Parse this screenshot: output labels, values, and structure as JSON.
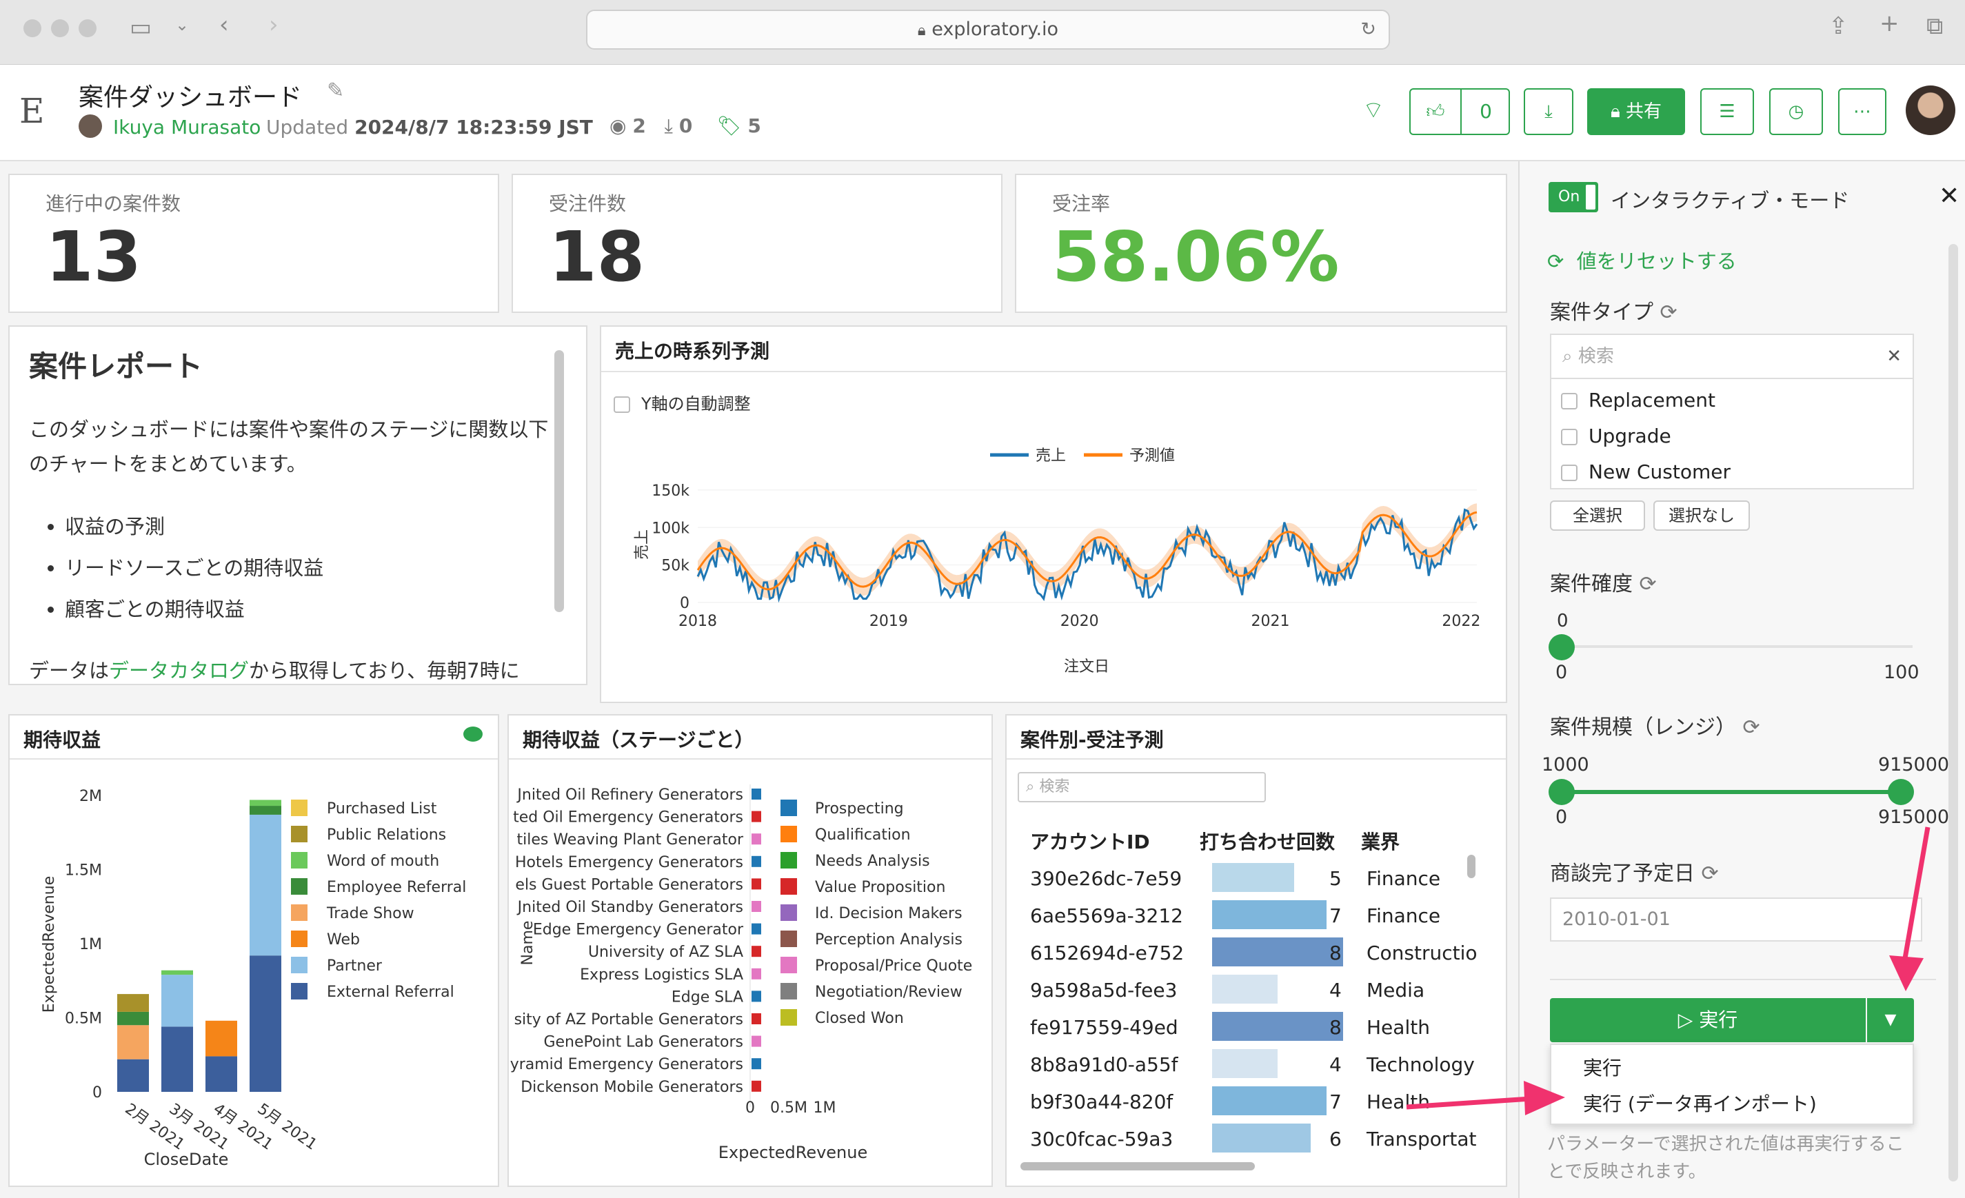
{
  "browser": {
    "url": "exploratory.io"
  },
  "header": {
    "logo": "E",
    "title": "案件ダッシュボード",
    "author": "Ikuya Murasato",
    "updated_label": "Updated",
    "updated_value": "2024/8/7 18:23:59 JST",
    "views": "2",
    "downloads": "0",
    "tags": "5",
    "like_count": "0",
    "share_label": "共有"
  },
  "kpis": [
    {
      "label": "進行中の案件数",
      "value": "13"
    },
    {
      "label": "受注件数",
      "value": "18"
    },
    {
      "label": "受注率",
      "value": "58.06%"
    }
  ],
  "report": {
    "title": "案件レポート",
    "intro": "このダッシュボードには案件や案件のステージに関数以下のチャートをまとめています。",
    "bullets": [
      "収益の予測",
      "リードソースごとの期待収益",
      "顧客ごとの期待収益"
    ],
    "footer_pre": "データは",
    "footer_link": "データカタログ",
    "footer_post": "から取得しており、毎朝7時に"
  },
  "forecast": {
    "title": "売上の時系列予測",
    "checkbox": "Y軸の自動調整"
  },
  "chart_data": [
    {
      "type": "line",
      "title": "売上の時系列予測",
      "xlabel": "注文日",
      "ylabel": "売上",
      "x_ticks": [
        "2018",
        "2019",
        "2020",
        "2021",
        "2022"
      ],
      "y_ticks": [
        "0",
        "50k",
        "100k",
        "150k"
      ],
      "ylim": [
        0,
        160000
      ],
      "legend": "top",
      "series": [
        {
          "name": "売上",
          "color": "#1f77b4"
        },
        {
          "name": "予測値",
          "color": "#ff7f0e"
        }
      ]
    },
    {
      "type": "bar",
      "title": "期待収益",
      "xlabel": "CloseDate",
      "ylabel": "ExpectedRevenue",
      "categories": [
        "2月 2021",
        "3月 2021",
        "4月 2021",
        "5月 2021"
      ],
      "y_ticks": [
        "0",
        "0.5M",
        "1M",
        "1.5M",
        "2M"
      ],
      "ylim": [
        0,
        2000000
      ],
      "legend": "right",
      "series": [
        {
          "name": "External Referral",
          "color": "#3c5f9c",
          "values": [
            220000,
            440000,
            240000,
            920000
          ]
        },
        {
          "name": "Partner",
          "color": "#8cc0e6",
          "values": [
            0,
            350000,
            0,
            950000
          ]
        },
        {
          "name": "Web",
          "color": "#f58518",
          "values": [
            0,
            0,
            240000,
            0
          ]
        },
        {
          "name": "Trade Show",
          "color": "#f5a55f",
          "values": [
            230000,
            0,
            0,
            0
          ]
        },
        {
          "name": "Employee Referral",
          "color": "#3a8c3a",
          "values": [
            90000,
            0,
            0,
            60000
          ]
        },
        {
          "name": "Word of mouth",
          "color": "#6bc95b",
          "values": [
            0,
            30000,
            0,
            40000
          ]
        },
        {
          "name": "Public Relations",
          "color": "#a8912a",
          "values": [
            120000,
            0,
            0,
            0
          ]
        },
        {
          "name": "Purchased List",
          "color": "#eec747",
          "values": [
            0,
            0,
            0,
            0
          ]
        }
      ]
    },
    {
      "type": "bar",
      "title": "期待収益（ステージごと）",
      "xlabel": "ExpectedRevenue",
      "ylabel": "Name",
      "categories": [
        "Jnited Oil Refinery Generators",
        "ted Oil Emergency Generators",
        "tiles Weaving Plant Generator",
        "Hotels Emergency Generators",
        "els Guest Portable Generators",
        "Jnited Oil Standby Generators",
        "Edge Emergency Generator",
        "University of AZ SLA",
        "Express Logistics SLA",
        "Edge SLA",
        "sity of AZ Portable Generators",
        "GenePoint Lab Generators",
        "yramid Emergency Generators",
        "Dickenson Mobile Generators"
      ],
      "x_ticks": [
        "0",
        "0.5M",
        "1M"
      ],
      "legend": "right",
      "series": [
        {
          "name": "Prospecting",
          "color": "#1f77b4"
        },
        {
          "name": "Qualification",
          "color": "#ff7f0e"
        },
        {
          "name": "Needs Analysis",
          "color": "#2ca02c"
        },
        {
          "name": "Value Proposition",
          "color": "#d62728"
        },
        {
          "name": "Id. Decision Makers",
          "color": "#9467bd"
        },
        {
          "name": "Perception Analysis",
          "color": "#8c564b"
        },
        {
          "name": "Proposal/Price Quote",
          "color": "#e377c2"
        },
        {
          "name": "Negotiation/Review",
          "color": "#7f7f7f"
        },
        {
          "name": "Closed Won",
          "color": "#bcbd22"
        }
      ]
    }
  ],
  "revenue_card": {
    "title": "期待収益"
  },
  "stage_card": {
    "title": "期待収益（ステージごと）"
  },
  "table": {
    "title": "案件別-受注予測",
    "search_placeholder": "検索",
    "columns": [
      "アカウントID",
      "打ち合わせ回数",
      "業界"
    ],
    "rows": [
      {
        "id": "390e26dc-7e59",
        "count": 5,
        "industry": "Finance"
      },
      {
        "id": "6ae5569a-3212",
        "count": 7,
        "industry": "Finance"
      },
      {
        "id": "6152694d-e752",
        "count": 8,
        "industry": "Constructio"
      },
      {
        "id": "9a598a5d-fee3",
        "count": 4,
        "industry": "Media"
      },
      {
        "id": "fe917559-49ed",
        "count": 8,
        "industry": "Health"
      },
      {
        "id": "8b8a91d0-a55f",
        "count": 4,
        "industry": "Technology"
      },
      {
        "id": "b9f30a44-820f",
        "count": 7,
        "industry": "Health"
      },
      {
        "id": "30c0fcac-59a3",
        "count": 6,
        "industry": "Transportat"
      }
    ]
  },
  "sidebar": {
    "toggle": "On",
    "mode_label": "インタラクティブ・モード",
    "reset": "値をリセットする",
    "type_label": "案件タイプ",
    "search_placeholder": "検索",
    "options": [
      "Replacement",
      "Upgrade",
      "New Customer"
    ],
    "select_all": "全選択",
    "select_none": "選択なし",
    "prob_label": "案件確度",
    "prob_value": "0",
    "prob_min": "0",
    "prob_max": "100",
    "size_label": "案件規模（レンジ）",
    "size_low": "1000",
    "size_high": "915000",
    "size_min": "0",
    "size_max": "915000",
    "date_label": "商談完了予定日",
    "date_value": "2010-01-01",
    "run": "実行",
    "menu": [
      "実行",
      "実行 (データ再インポート)"
    ],
    "note": "パラメーターで選択された値は再実行することで反映されます。"
  }
}
